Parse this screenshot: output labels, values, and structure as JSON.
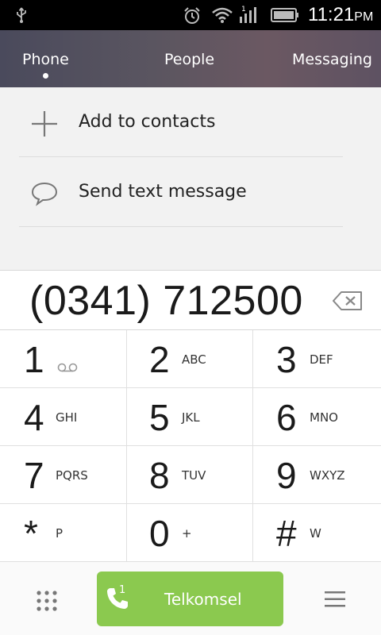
{
  "status_bar": {
    "time": "11:21",
    "ampm": "PM",
    "icons": [
      "usb-icon",
      "alarm-icon",
      "wifi-icon",
      "signal-icon",
      "battery-icon"
    ],
    "signal_sim_label": "1"
  },
  "tabs": [
    {
      "label": "Phone",
      "active": true
    },
    {
      "label": "People",
      "active": false
    },
    {
      "label": "Messaging",
      "active": false
    }
  ],
  "suggestions": {
    "add_contact": {
      "label": "Add to contacts",
      "icon": "plus-icon"
    },
    "send_text": {
      "label": "Send text message",
      "icon": "speech-bubble-icon"
    }
  },
  "dialer": {
    "number": "(0341) 712500"
  },
  "keypad": [
    {
      "digit": "1",
      "letters": ""
    },
    {
      "digit": "2",
      "letters": "ABC"
    },
    {
      "digit": "3",
      "letters": "DEF"
    },
    {
      "digit": "4",
      "letters": "GHI"
    },
    {
      "digit": "5",
      "letters": "JKL"
    },
    {
      "digit": "6",
      "letters": "MNO"
    },
    {
      "digit": "7",
      "letters": "PQRS"
    },
    {
      "digit": "8",
      "letters": "TUV"
    },
    {
      "digit": "9",
      "letters": "WXYZ"
    },
    {
      "digit": "*",
      "letters": "P"
    },
    {
      "digit": "0",
      "letters": "+"
    },
    {
      "digit": "#",
      "letters": "W"
    }
  ],
  "action_bar": {
    "call_carrier": "Telkomsel",
    "call_sim": "1"
  },
  "colors": {
    "call_button": "#8bc94f",
    "tab_bar": "#55505e",
    "status_bar": "#000000"
  }
}
